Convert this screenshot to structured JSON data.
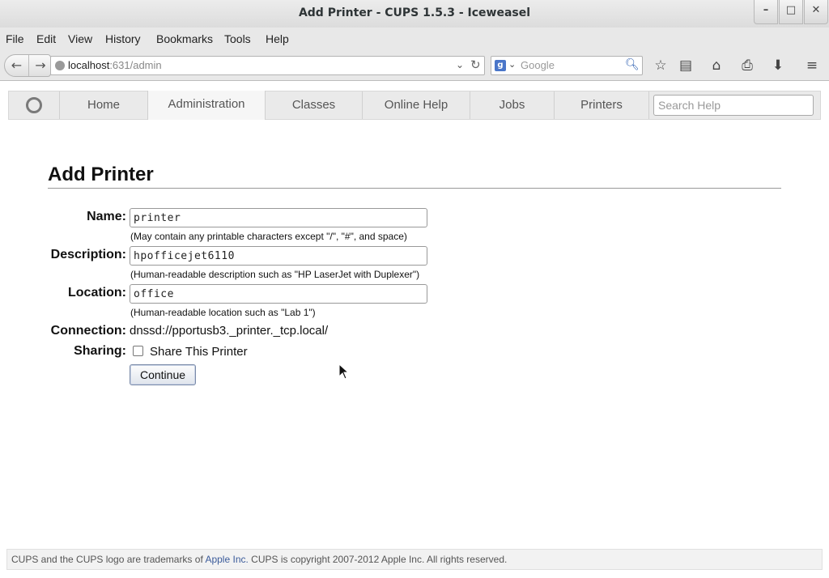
{
  "window": {
    "title": "Add Printer - CUPS 1.5.3 - Iceweasel",
    "controls": [
      "minimize",
      "maximize",
      "close"
    ]
  },
  "menubar": {
    "items": [
      {
        "label": "File",
        "accel": "F"
      },
      {
        "label": "Edit",
        "accel": "E"
      },
      {
        "label": "View",
        "accel": "V"
      },
      {
        "label": "History",
        "accel": "s"
      },
      {
        "label": "Bookmarks",
        "accel": "B"
      },
      {
        "label": "Tools",
        "accel": "T"
      },
      {
        "label": "Help",
        "accel": "H"
      }
    ]
  },
  "navbar": {
    "url_host": "localhost",
    "url_rest": ":631/admin",
    "search_placeholder": "Google"
  },
  "cups": {
    "tabs": [
      "Home",
      "Administration",
      "Classes",
      "Online Help",
      "Jobs",
      "Printers"
    ],
    "active_tab": "Administration",
    "help_search_placeholder": "Search Help"
  },
  "form": {
    "heading": "Add Printer",
    "name_label": "Name:",
    "name_value": "printer",
    "name_hint": "(May contain any printable characters except \"/\", \"#\", and space)",
    "description_label": "Description:",
    "description_value": "hpofficejet6110",
    "description_hint": "(Human-readable description such as \"HP LaserJet with Duplexer\")",
    "location_label": "Location:",
    "location_value": "office",
    "location_hint": "(Human-readable location such as \"Lab 1\")",
    "connection_label": "Connection:",
    "connection_value": "dnssd://pportusb3._printer._tcp.local/",
    "sharing_label": "Sharing:",
    "sharing_option": "Share This Printer",
    "sharing_checked": false,
    "continue_label": "Continue"
  },
  "footer": {
    "text_before": "CUPS and the CUPS logo are trademarks of ",
    "link": "Apple Inc.",
    "text_after": " CUPS is copyright 2007-2012 Apple Inc. All rights reserved."
  },
  "colors": {
    "link": "#3b5b9a",
    "tab_bg": "#eaeaea",
    "active_tab_bg": "#f6f6f6"
  }
}
